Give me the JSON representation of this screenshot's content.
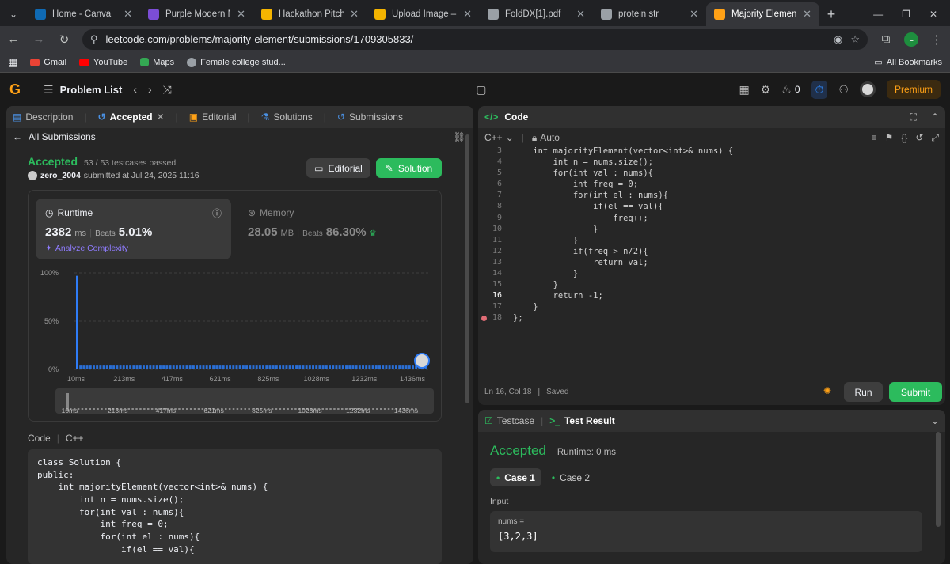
{
  "browser": {
    "tabs": [
      {
        "title": "Home - Canva",
        "color": "#0f6ab4"
      },
      {
        "title": "Purple Modern Minim",
        "color": "#7b4dd6"
      },
      {
        "title": "Hackathon Pitch Dec",
        "color": "#f4b400"
      },
      {
        "title": "Upload Image – rem",
        "color": "#f4b400"
      },
      {
        "title": "FoldDX[1].pdf",
        "color": "#9aa0a6"
      },
      {
        "title": "protein str",
        "color": "#9aa0a6"
      },
      {
        "title": "Majority Element - Le",
        "color": "#ffa116"
      }
    ],
    "url": "leetcode.com/problems/majority-element/submissions/1709305833/",
    "profile_initial": "L",
    "bookmarks": [
      "Gmail",
      "YouTube",
      "Maps",
      "Female college stud..."
    ],
    "all_bookmarks": "All Bookmarks"
  },
  "lcnav": {
    "problem_list": "Problem List",
    "fire_count": "0",
    "premium": "Premium"
  },
  "left": {
    "tabs": [
      "Description",
      "Accepted",
      "Editorial",
      "Solutions",
      "Submissions"
    ],
    "back_label": "All Submissions",
    "status": "Accepted",
    "testcases": "53 / 53 testcases passed",
    "user": "zero_2004",
    "submitted": "submitted at Jul 24, 2025 11:16",
    "editorial_btn": "Editorial",
    "solution_btn": "Solution",
    "runtime_label": "Runtime",
    "runtime_value": "2382",
    "runtime_unit": "ms",
    "beats_label": "Beats",
    "runtime_beats": "5.01%",
    "analyze": "Analyze Complexity",
    "memory_label": "Memory",
    "memory_value": "28.05",
    "memory_unit": "MB",
    "memory_beats": "86.30%",
    "code_label": "Code",
    "code_lang": "C++"
  },
  "chart_data": {
    "type": "bar",
    "yticks": [
      "100%",
      "50%",
      "0%"
    ],
    "xticks": [
      "10ms",
      "213ms",
      "417ms",
      "621ms",
      "825ms",
      "1028ms",
      "1232ms",
      "1436ms"
    ],
    "values": [
      97,
      4,
      4,
      4,
      4,
      4,
      4,
      4,
      4,
      4,
      4,
      4,
      4,
      4,
      4,
      4,
      4,
      4,
      4,
      4,
      4,
      4,
      4,
      4,
      4,
      4,
      4,
      4,
      4,
      4,
      4,
      4,
      4,
      4,
      4,
      4,
      4,
      4,
      4,
      4,
      4,
      4,
      4,
      4,
      4,
      4,
      4,
      4,
      4,
      4,
      4,
      4,
      4,
      4,
      4,
      4,
      4,
      4,
      4,
      4,
      4,
      4,
      4,
      4,
      4,
      4,
      4,
      4,
      4,
      4,
      4,
      4,
      4,
      4,
      4,
      4,
      4,
      4,
      4,
      4,
      4,
      4,
      4,
      4,
      4,
      4,
      4,
      4,
      4,
      4,
      4,
      4,
      4,
      4,
      4,
      4,
      4,
      4,
      4,
      4,
      4,
      4,
      4,
      4,
      4,
      4
    ]
  },
  "code_preview": [
    "class Solution {",
    "public:",
    "    int majorityElement(vector<int>& nums) {",
    "        int n = nums.size();",
    "        for(int val : nums){",
    "            int freq = 0;",
    "            for(int el : nums){",
    "                if(el == val){"
  ],
  "editor": {
    "title": "Code",
    "lang": "C++",
    "mode": "Auto",
    "lines": [
      {
        "n": "3",
        "t": "    int majorityElement(vector<int>& nums) {"
      },
      {
        "n": "4",
        "t": "        int n = nums.size();"
      },
      {
        "n": "5",
        "t": "        for(int val : nums){"
      },
      {
        "n": "6",
        "t": "            int freq = 0;"
      },
      {
        "n": "7",
        "t": "            for(int el : nums){"
      },
      {
        "n": "8",
        "t": "                if(el == val){"
      },
      {
        "n": "9",
        "t": "                    freq++;"
      },
      {
        "n": "10",
        "t": "                }"
      },
      {
        "n": "11",
        "t": "            }"
      },
      {
        "n": "12",
        "t": "            if(freq > n/2){"
      },
      {
        "n": "13",
        "t": "                return val;"
      },
      {
        "n": "14",
        "t": "            }"
      },
      {
        "n": "15",
        "t": "        }"
      },
      {
        "n": "16",
        "t": "        return -1;"
      },
      {
        "n": "17",
        "t": "    }"
      },
      {
        "n": "18",
        "t": "};"
      }
    ],
    "status": "Ln 16, Col 18",
    "saved": "Saved",
    "run": "Run",
    "submit": "Submit"
  },
  "test": {
    "tab_testcase": "Testcase",
    "tab_result": "Test Result",
    "status": "Accepted",
    "runtime": "Runtime: 0 ms",
    "case1": "Case 1",
    "case2": "Case 2",
    "input_label": "Input",
    "var": "nums =",
    "value": "[3,2,3]"
  }
}
